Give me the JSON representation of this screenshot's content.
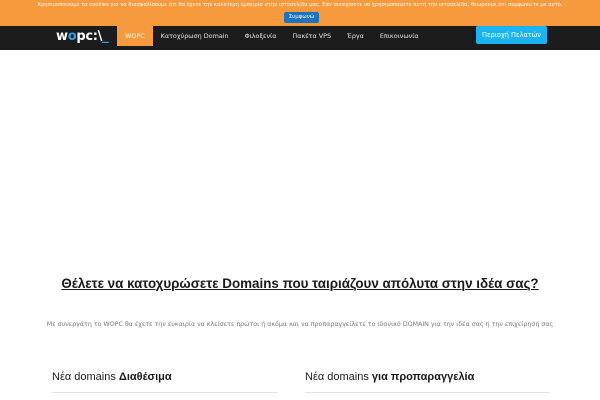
{
  "cookie": {
    "text": "Χρησιμοποιούμε τα cookies για να διασφαλίσουμε ότι θα έχετε την καλύτερη εμπειρία στην ιστοσελίδα μας. Εάν συνεχίσετε να χρησιμοποιείτε αυτή την ιστοσελίδα, θεωρούμε ότι συμφωνείτε με αυτό.",
    "accept_label": "Συμφωνώ"
  },
  "nav": {
    "logo_prefix": "w",
    "logo_ring": "o",
    "logo_suffix": "pc:\\",
    "logo_cursor": "_",
    "items": [
      {
        "label": "WOPC",
        "active": true
      },
      {
        "label": "Κατοχύρωση Domain",
        "active": false
      },
      {
        "label": "Φιλοξενία",
        "active": false
      },
      {
        "label": "Πακέτα VPS",
        "active": false
      },
      {
        "label": "Έργα",
        "active": false
      },
      {
        "label": "Επικοινωνία",
        "active": false
      }
    ],
    "client_area_label": "Περιοχή Πελατών"
  },
  "main": {
    "heading": "Θέλετε να κατοχυρώσετε Domains που ταιριάζουν απόλυτα στην ιδέα σας?",
    "subtitle": "Με συνεργάτη το WOPC θα έχετε την ευκαιρία να κλείσετε πρώτοι ή ακόμα και να προπαραγγείλετε το ιδανικό DOMAIN για την ιδέα σας ή την επιχείρησή σας",
    "available": {
      "prefix": "Νέα domains",
      "bold": "Διαθέσιμα"
    },
    "preorder": {
      "prefix": "Νέα domains",
      "bold": "για προπαραγγελία"
    }
  },
  "colors": {
    "accent_orange": "#f79a3e",
    "nav_dark": "#1c1c1c",
    "client_blue": "#1bb4f0",
    "cookie_button_blue": "#1e73be"
  }
}
